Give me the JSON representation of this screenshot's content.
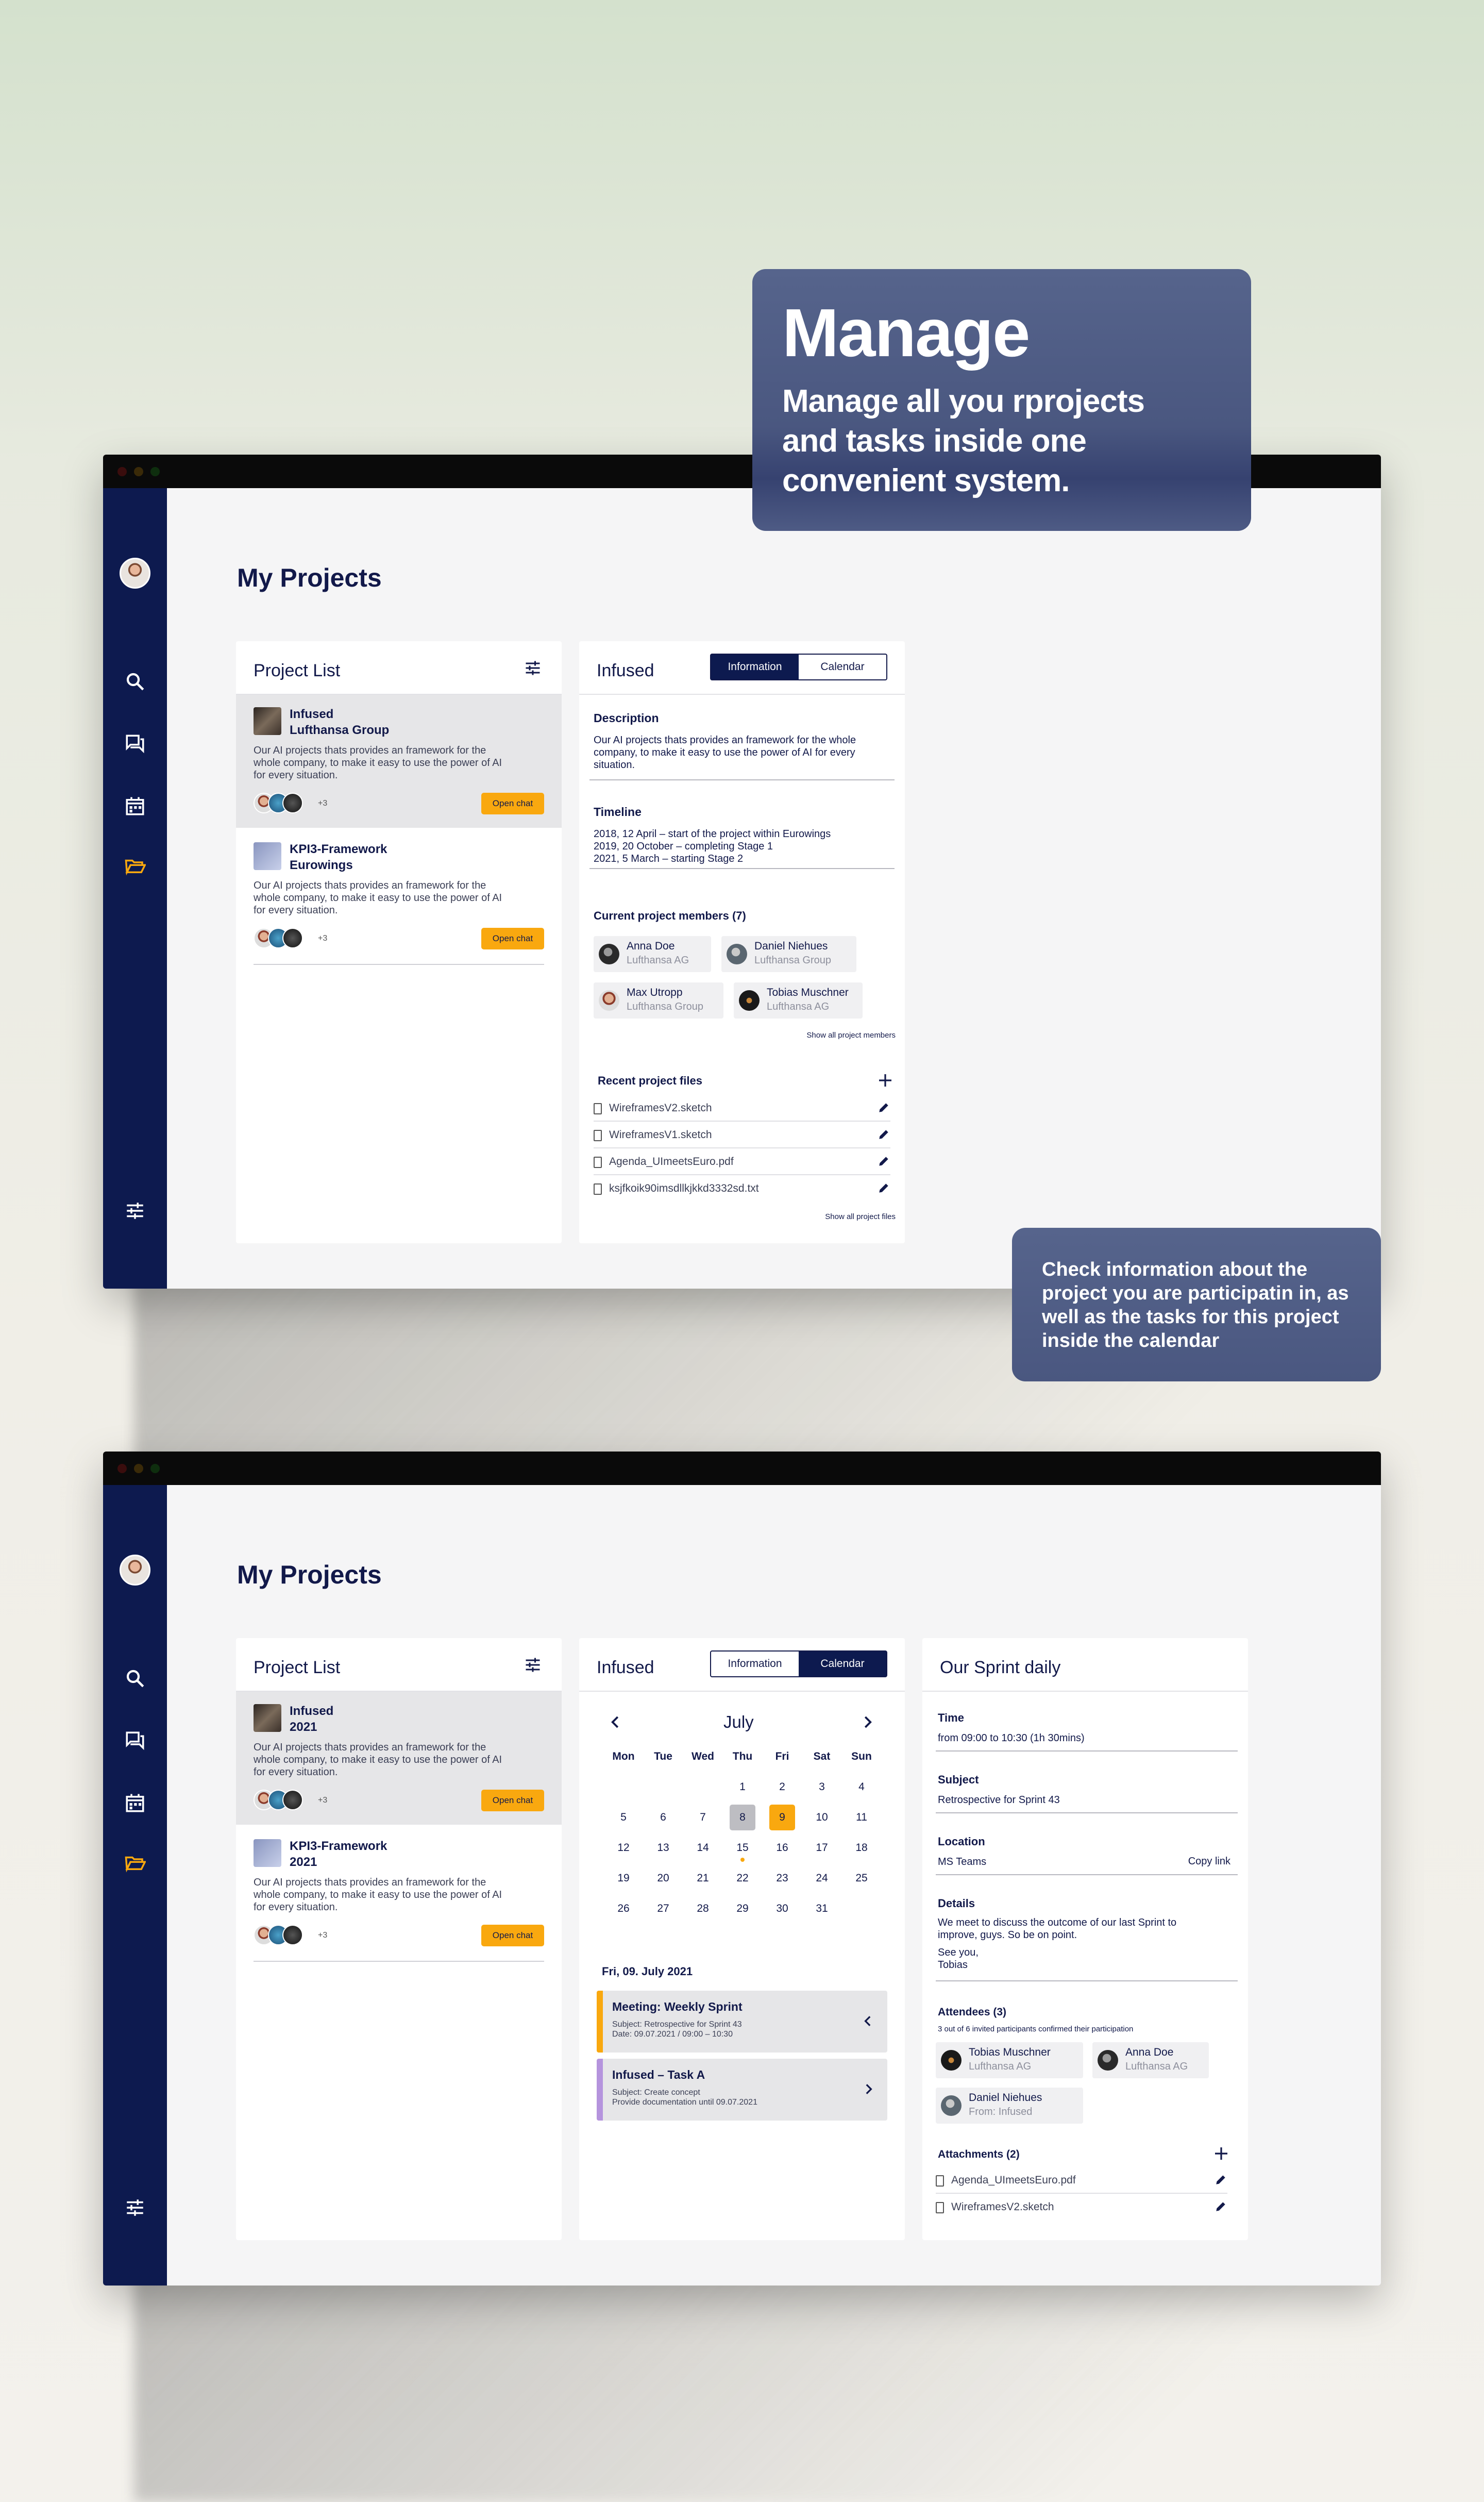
{
  "hero": {
    "title": "Manage",
    "subtitle_line1": "Manage all you rprojects",
    "subtitle_line2": "and tasks inside one",
    "subtitle_line3": "convenient system."
  },
  "callout2": {
    "line1": "Check information about the",
    "line2": "project you are participatin in, as",
    "line3": "well as the tasks for this project",
    "line4": "inside the calendar"
  },
  "colors": {
    "navy": "#0d1a4f",
    "accent": "#f9a80f",
    "callout": "#4e5b85"
  },
  "sidebar_icons": [
    "search-icon",
    "chat-icon",
    "calendar-icon",
    "folder-icon",
    "settings-sliders-icon"
  ],
  "screen1": {
    "page_title": "My Projects",
    "project_list": {
      "title": "Project List",
      "items": [
        {
          "name": "Infused",
          "company": "Lufthansa Group",
          "desc_1": "Our AI projects thats provides an framework for the",
          "desc_2": "whole company, to make it easy to use the power of AI",
          "desc_3": "for every situation.",
          "more": "+3",
          "button": "Open chat"
        },
        {
          "name": "KPI3-Framework",
          "company": "Eurowings",
          "desc_1": "Our AI projects thats provides an framework for the",
          "desc_2": "whole company, to make it easy to use the power of AI",
          "desc_3": "for every situation.",
          "more": "+3",
          "button": "Open chat"
        }
      ]
    },
    "detail": {
      "title": "Infused",
      "tab_info": "Information",
      "tab_calendar": "Calendar",
      "description_label": "Description",
      "description_1": "Our AI projects thats provides an framework for the whole",
      "description_2": "company, to make it easy to use the power of AI for every",
      "description_3": "situation.",
      "timeline_label": "Timeline",
      "timeline_1": "2018, 12 April – start of the project within Eurowings",
      "timeline_2": "2019, 20 October – completing Stage 1",
      "timeline_3": "2021, 5 March – starting Stage 2",
      "members_label": "Current project members (7)",
      "members": [
        {
          "name": "Anna Doe",
          "company": "Lufthansa AG"
        },
        {
          "name": "Daniel Niehues",
          "company": "Lufthansa Group"
        },
        {
          "name": "Max Utropp",
          "company": "Lufthansa Group"
        },
        {
          "name": "Tobias Muschner",
          "company": "Lufthansa AG"
        }
      ],
      "show_members": "Show all project members",
      "files_label": "Recent project files",
      "files": [
        "WireframesV2.sketch",
        "WireframesV1.sketch",
        "Agenda_UImeetsEuro.pdf",
        "ksjfkoik90imsdllkjkkd3332sd.txt"
      ],
      "show_files": "Show all project files"
    }
  },
  "screen2": {
    "page_title": "My Projects",
    "project_list": {
      "title": "Project List",
      "items": [
        {
          "name": "Infused",
          "company": "2021",
          "desc_1": "Our AI projects thats provides an framework for the",
          "desc_2": "whole company, to make it easy to use the power of AI",
          "desc_3": "for every situation.",
          "more": "+3",
          "button": "Open chat"
        },
        {
          "name": "KPI3-Framework",
          "company": "2021",
          "desc_1": "Our AI projects thats provides an framework for the",
          "desc_2": "whole company, to make it easy to use the power of AI",
          "desc_3": "for every situation.",
          "more": "+3",
          "button": "Open chat"
        }
      ]
    },
    "calendar": {
      "title": "Infused",
      "tab_info": "Information",
      "tab_calendar": "Calendar",
      "month": "July",
      "weekdays": [
        "Mon",
        "Tue",
        "Wed",
        "Thu",
        "Fri",
        "Sat",
        "Sun"
      ],
      "weeks": [
        [
          "",
          "",
          "",
          "1",
          "2",
          "3",
          "4"
        ],
        [
          "5",
          "6",
          "7",
          "8",
          "9",
          "10",
          "11"
        ],
        [
          "12",
          "13",
          "14",
          "15",
          "16",
          "17",
          "18"
        ],
        [
          "19",
          "20",
          "21",
          "22",
          "23",
          "24",
          "25"
        ],
        [
          "26",
          "27",
          "28",
          "29",
          "30",
          "31",
          ""
        ]
      ],
      "selected_day": "9",
      "today_day": "8",
      "marked_day": "15",
      "date_label": "Fri, 09. July 2021",
      "events": [
        {
          "title": "Meeting: Weekly Sprint",
          "line1": "Subject: Retrospective for Sprint 43",
          "line2": "Date: 09.07.2021 / 09:00 – 10:30"
        },
        {
          "title": "Infused – Task A",
          "line1": "Subject: Create concept",
          "line2": "Provide documentation until 09.07.2021"
        }
      ]
    },
    "sprint": {
      "title": "Our Sprint daily",
      "time_label": "Time",
      "time_value": "from 09:00 to 10:30 (1h 30mins)",
      "subject_label": "Subject",
      "subject_value": "Retrospective for Sprint 43",
      "location_label": "Location",
      "location_value": "MS Teams",
      "copy_link": "Copy link",
      "details_label": "Details",
      "details_1": "We meet to discuss the outcome of our last Sprint to",
      "details_2": "improve, guys. So be on point.",
      "details_3": "See you,",
      "details_4": "Tobias",
      "attendees_label": "Attendees (3)",
      "attendees_note": "3 out of 6 invited participants confirmed their participation",
      "attendees": [
        {
          "name": "Tobias Muschner",
          "company": "Lufthansa AG"
        },
        {
          "name": "Anna Doe",
          "company": "Lufthansa AG"
        },
        {
          "name": "Daniel Niehues",
          "company": "From: Infused"
        }
      ],
      "attachments_label": "Attachments (2)",
      "attachments": [
        "Agenda_UImeetsEuro.pdf",
        "WireframesV2.sketch"
      ]
    }
  }
}
